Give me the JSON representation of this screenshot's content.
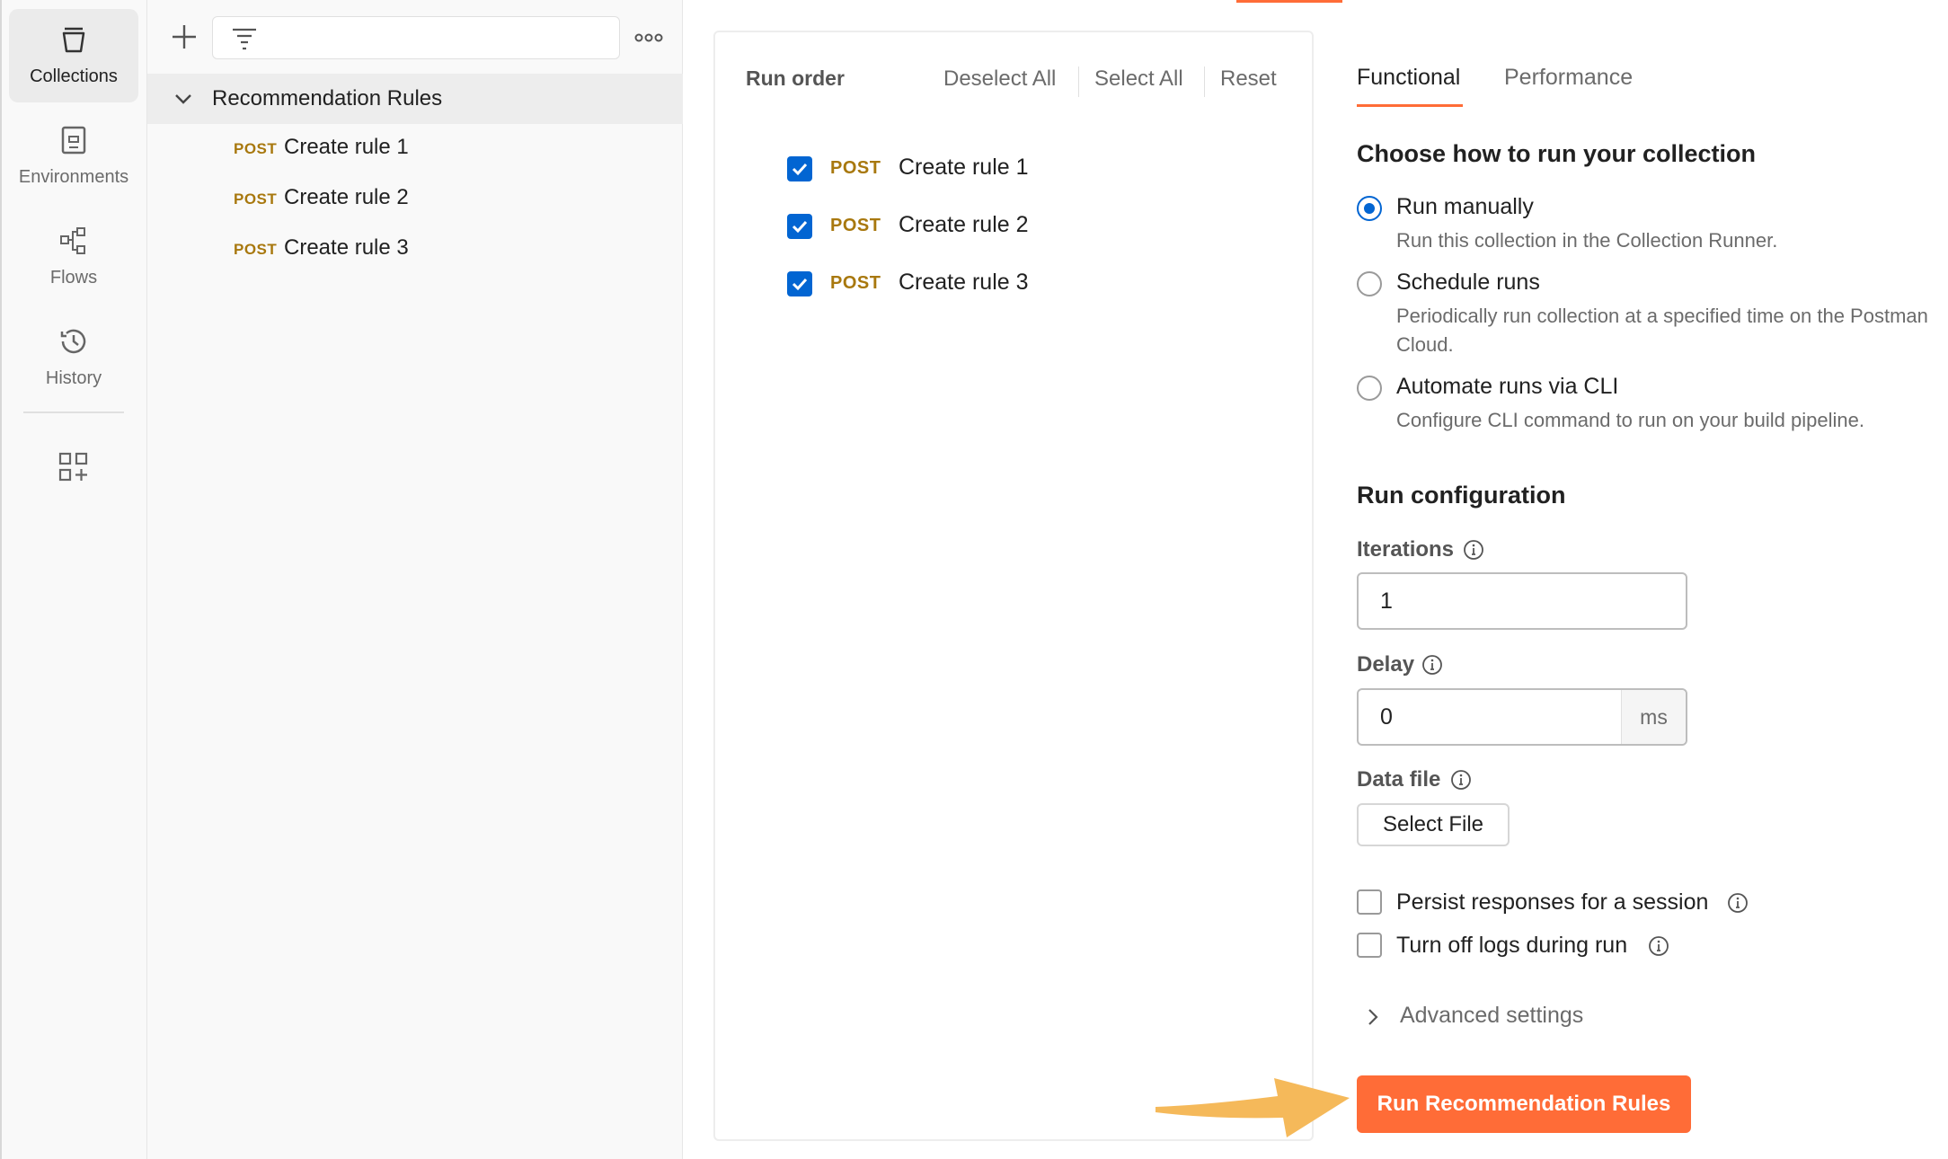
{
  "rail": {
    "items": [
      {
        "label": "Collections",
        "icon": "collections-icon"
      },
      {
        "label": "Environments",
        "icon": "environments-icon"
      },
      {
        "label": "Flows",
        "icon": "flows-icon"
      },
      {
        "label": "History",
        "icon": "history-icon"
      }
    ],
    "extra_icon": "add-workspace-icon"
  },
  "sidebar": {
    "filter_placeholder": "",
    "collection": {
      "name": "Recommendation Rules",
      "requests": [
        {
          "method": "POST",
          "name": "Create rule 1"
        },
        {
          "method": "POST",
          "name": "Create rule 2"
        },
        {
          "method": "POST",
          "name": "Create rule 3"
        }
      ]
    }
  },
  "run_order": {
    "title": "Run order",
    "deselect_all": "Deselect All",
    "select_all": "Select All",
    "reset": "Reset",
    "items": [
      {
        "method": "POST",
        "name": "Create rule 1",
        "checked": true
      },
      {
        "method": "POST",
        "name": "Create rule 2",
        "checked": true
      },
      {
        "method": "POST",
        "name": "Create rule 3",
        "checked": true
      }
    ]
  },
  "config": {
    "tabs": [
      {
        "label": "Functional",
        "active": true
      },
      {
        "label": "Performance",
        "active": false
      }
    ],
    "choose_heading": "Choose how to run your collection",
    "options": [
      {
        "label": "Run manually",
        "desc": "Run this collection in the Collection Runner.",
        "selected": true
      },
      {
        "label": "Schedule runs",
        "desc": "Periodically run collection at a specified time on the Postman Cloud.",
        "selected": false
      },
      {
        "label": "Automate runs via CLI",
        "desc": "Configure CLI command to run on your build pipeline.",
        "selected": false
      }
    ],
    "run_config_heading": "Run configuration",
    "iterations": {
      "label": "Iterations",
      "value": "1"
    },
    "delay": {
      "label": "Delay",
      "value": "0",
      "unit": "ms"
    },
    "data_file": {
      "label": "Data file",
      "button": "Select File"
    },
    "persist_label": "Persist responses for a session",
    "logs_label": "Turn off logs during run",
    "advanced_label": "Advanced settings",
    "run_button": "Run Recommendation Rules"
  },
  "colors": {
    "accent": "#ff6c37",
    "checkbox": "#0265d2",
    "method_post": "#a8780e",
    "arrow": "#f5b95a"
  }
}
